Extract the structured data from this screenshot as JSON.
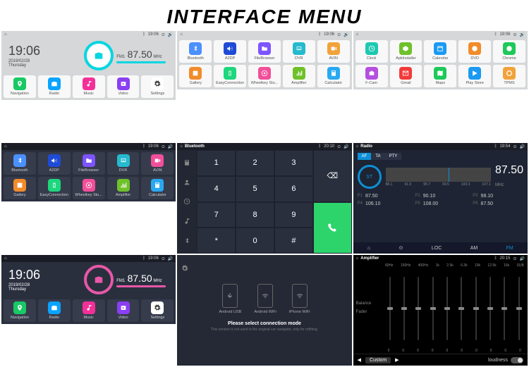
{
  "title": "INTERFACE MENU",
  "status": {
    "time_1906": "19:06",
    "time_1954": "19:54",
    "time_2010": "20:10",
    "time_2015": "20:15"
  },
  "home": {
    "time": "19:06",
    "date": "2019/02/28",
    "day": "Thursday",
    "band": "FM1",
    "freq": "87.50",
    "unit": "MHz",
    "nav": [
      {
        "label": "Navigation",
        "color": "#18c964",
        "svg": "pin"
      },
      {
        "label": "Radio",
        "color": "#0aa3ff",
        "svg": "radio"
      },
      {
        "label": "Music",
        "color": "#f43098",
        "svg": "music"
      },
      {
        "label": "Video",
        "color": "#8a3ff2",
        "svg": "video"
      },
      {
        "label": "Settings",
        "color": "#ffffff",
        "svg": "gear",
        "icolor": "#333"
      }
    ]
  },
  "apps_p2": [
    {
      "label": "Bluetooth",
      "color": "#4a90ff",
      "svg": "bt"
    },
    {
      "label": "A2DP",
      "color": "#1e4bd6",
      "svg": "a2dp"
    },
    {
      "label": "FileBrowser",
      "color": "#7d54ff",
      "svg": "folder"
    },
    {
      "label": "DVR",
      "color": "#25bace",
      "svg": "dvr"
    },
    {
      "label": "AVIN",
      "color": "#f2a23a",
      "svg": "avin"
    },
    {
      "label": "Gallery",
      "color": "#f28b2a",
      "svg": "gallery"
    },
    {
      "label": "EasyConnection",
      "color": "#1dd67d",
      "svg": "ec"
    },
    {
      "label": "Wheelkey Stu...",
      "color": "#f24f9a",
      "svg": "wheel"
    },
    {
      "label": "Amplifier",
      "color": "#6fc12a",
      "svg": "eq"
    },
    {
      "label": "Calculator",
      "color": "#2aa9f2",
      "svg": "calc"
    }
  ],
  "apps_p3": [
    {
      "label": "Clock",
      "color": "#1dc9b0",
      "svg": "clock"
    },
    {
      "label": "ApkInstaller",
      "color": "#6fc12a",
      "svg": "apk"
    },
    {
      "label": "Calendar",
      "color": "#1a9af2",
      "svg": "cal"
    },
    {
      "label": "DVD",
      "color": "#f28b2a",
      "svg": "dvd"
    },
    {
      "label": "Chrome",
      "color": "#1dc95a",
      "svg": "chrome"
    },
    {
      "label": "F-Cam",
      "color": "#b44fe0",
      "svg": "cam"
    },
    {
      "label": "Gmail",
      "color": "#f23a3a",
      "svg": "mail"
    },
    {
      "label": "Maps",
      "color": "#1dc95a",
      "svg": "maps"
    },
    {
      "label": "Play Store",
      "color": "#1a9af2",
      "svg": "play"
    },
    {
      "label": "TPMS",
      "color": "#f2a23a",
      "svg": "tpms"
    }
  ],
  "apps_p4": [
    {
      "label": "Bluetooth",
      "color": "#4a90ff",
      "svg": "bt"
    },
    {
      "label": "A2DP",
      "color": "#1e4bd6",
      "svg": "a2dp"
    },
    {
      "label": "FileBrowser",
      "color": "#7d54ff",
      "svg": "folder"
    },
    {
      "label": "DVR",
      "color": "#25bace",
      "svg": "dvr"
    },
    {
      "label": "AVIN",
      "color": "#f24f9a",
      "svg": "avin"
    },
    {
      "label": "Gallery",
      "color": "#f28b2a",
      "svg": "gallery"
    },
    {
      "label": "EasyConnection",
      "color": "#1dd67d",
      "svg": "ec"
    },
    {
      "label": "Wheelkey Stu...",
      "color": "#f24f9a",
      "svg": "wheel"
    },
    {
      "label": "Amplifier",
      "color": "#6fc12a",
      "svg": "eq"
    },
    {
      "label": "Calculator",
      "color": "#2aa9f2",
      "svg": "calc"
    }
  ],
  "bt": {
    "title": "Bluetooth",
    "keys": [
      "1",
      "2",
      "3",
      "4",
      "5",
      "6",
      "7",
      "8",
      "9",
      "*",
      "0",
      "#"
    ]
  },
  "radio": {
    "title": "Radio",
    "tabs": [
      "AF",
      "TA",
      "PTY"
    ],
    "st": "ST",
    "freq": "87.50",
    "unit": "MHz",
    "ticks": [
      "88.1",
      "91.9",
      "95.7",
      "99.5",
      "103.3",
      "107.1"
    ],
    "presets": [
      {
        "n": "P1",
        "v": "87.50"
      },
      {
        "n": "P2",
        "v": "90.10"
      },
      {
        "n": "P3",
        "v": "98.10"
      },
      {
        "n": "P4",
        "v": "106.10"
      },
      {
        "n": "P5",
        "v": "108.00"
      },
      {
        "n": "P6",
        "v": "87.50"
      }
    ],
    "bottom": [
      "⌂",
      "⊙",
      "LOC",
      "AM",
      "FM"
    ]
  },
  "home2": {
    "time": "19:06",
    "date": "2019/02/28",
    "day": "Thursday",
    "band": "FM1",
    "freq": "87.50",
    "unit": "MHz"
  },
  "conn": {
    "options": [
      "Android USB",
      "Android WiFi",
      "iPhone WiFi"
    ],
    "msg": "Please select connection mode",
    "sub": "This version is not used in the original car navigator, only for refitting."
  },
  "eq": {
    "title": "Amplifier",
    "side": [
      "Balance",
      "Fader"
    ],
    "freqs": [
      "60Hz",
      "150Hz",
      "400Hz",
      "1k",
      "2.5k",
      "6.3k",
      "10k",
      "12.5k",
      "16k",
      "SUB"
    ],
    "vals": [
      "0",
      "0",
      "0",
      "0",
      "0",
      "0",
      "0",
      "0",
      "0",
      "0"
    ],
    "custom": "Custom",
    "loud": "loudness"
  }
}
